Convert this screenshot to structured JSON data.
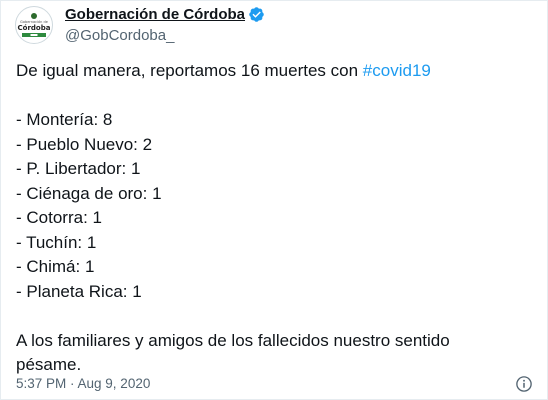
{
  "author": {
    "display_name": "Gobernación de Córdoba",
    "handle": "@GobCordoba_",
    "avatar": {
      "small_text": "Gobernación de",
      "big_text": "Córdoba"
    },
    "verified_icon": "verified-badge-icon"
  },
  "tweet": {
    "intro_prefix": "De igual manera, reportamos 16 muertes con ",
    "hashtag": "#covid19",
    "items": [
      "- Montería: 8",
      "- Pueblo Nuevo: 2",
      "- P. Libertador: 1",
      "- Ciénaga de oro: 1",
      "- Cotorra: 1",
      "- Tuchín: 1",
      "- Chimá: 1",
      "- Planeta Rica: 1"
    ],
    "closing_line1": "A los familiares y amigos de los fallecidos nuestro sentido",
    "closing_line2": "pésame."
  },
  "footer": {
    "timestamp": "5:37 PM · Aug 9, 2020",
    "info_icon": "info-icon"
  },
  "colors": {
    "link": "#1d9bf0",
    "secondary_text": "#536471",
    "primary_text": "#0f1419"
  }
}
